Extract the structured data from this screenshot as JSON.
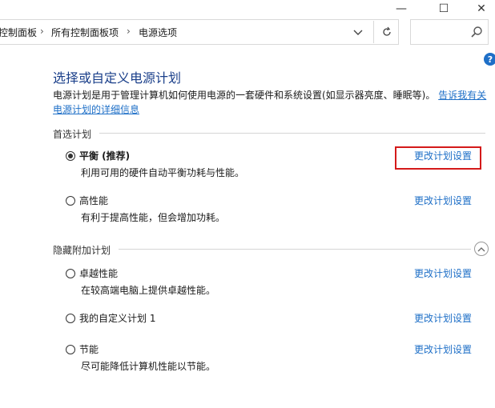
{
  "window": {
    "minimize_glyph": "—",
    "maximize_glyph": "☐",
    "close_glyph": "✕"
  },
  "address": {
    "crumbs": [
      "控制面板",
      "所有控制面板项",
      "电源选项"
    ],
    "separator": "›",
    "search_placeholder": ""
  },
  "page": {
    "title": "选择或自定义电源计划",
    "description": "电源计划是用于管理计算机如何使用电源的一套硬件和系统设置(如显示器亮度、睡眠等)。",
    "description_link": "告诉我有关电源计划的详细信息"
  },
  "preferred": {
    "header": "首选计划",
    "plans": [
      {
        "name": "平衡 (推荐)",
        "desc": "利用可用的硬件自动平衡功耗与性能。",
        "link": "更改计划设置",
        "selected": true
      },
      {
        "name": "高性能",
        "desc": "有利于提高性能，但会增加功耗。",
        "link": "更改计划设置",
        "selected": false
      }
    ]
  },
  "hidden": {
    "header": "隐藏附加计划",
    "plans": [
      {
        "name": "卓越性能",
        "desc": "在较高端电脑上提供卓越性能。",
        "link": "更改计划设置",
        "selected": false
      },
      {
        "name": "我的自定义计划 1",
        "desc": "",
        "link": "更改计划设置",
        "selected": false
      },
      {
        "name": "节能",
        "desc": "尽可能降低计算机性能以节能。",
        "link": "更改计划设置",
        "selected": false
      }
    ]
  },
  "colors": {
    "link": "#1e6fc7",
    "title": "#1a3f8a",
    "highlight": "#d41a1a"
  }
}
